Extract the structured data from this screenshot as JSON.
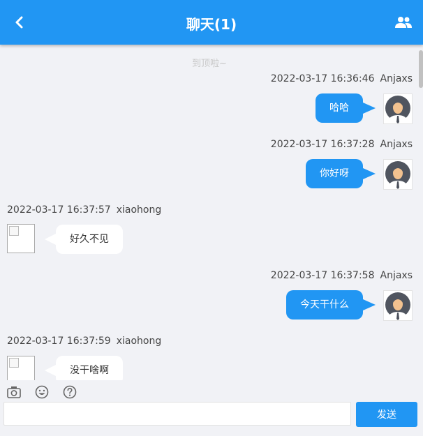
{
  "header": {
    "title": "聊天(1)",
    "back_icon": "chevron-left-icon",
    "group_icon": "people-icon"
  },
  "chat": {
    "top_note": "到顶啦~",
    "messages": [
      {
        "side": "right",
        "time": "2022-03-17 16:36:46",
        "user": "Anjaxs",
        "text": "哈哈"
      },
      {
        "side": "right",
        "time": "2022-03-17 16:37:28",
        "user": "Anjaxs",
        "text": "你好呀"
      },
      {
        "side": "left",
        "time": "2022-03-17 16:37:57",
        "user": "xiaohong",
        "text": "好久不见"
      },
      {
        "side": "right",
        "time": "2022-03-17 16:37:58",
        "user": "Anjaxs",
        "text": "今天干什么"
      },
      {
        "side": "left",
        "time": "2022-03-17 16:37:59",
        "user": "xiaohong",
        "text": "没干啥啊"
      }
    ]
  },
  "toolbar": {
    "icons": [
      "camera-icon",
      "emoji-icon",
      "help-icon"
    ],
    "input_value": "",
    "input_placeholder": "",
    "send_label": "发送"
  },
  "colors": {
    "primary": "#2196f3",
    "background": "#f1f2f6",
    "incoming_bubble": "#ffffff"
  }
}
